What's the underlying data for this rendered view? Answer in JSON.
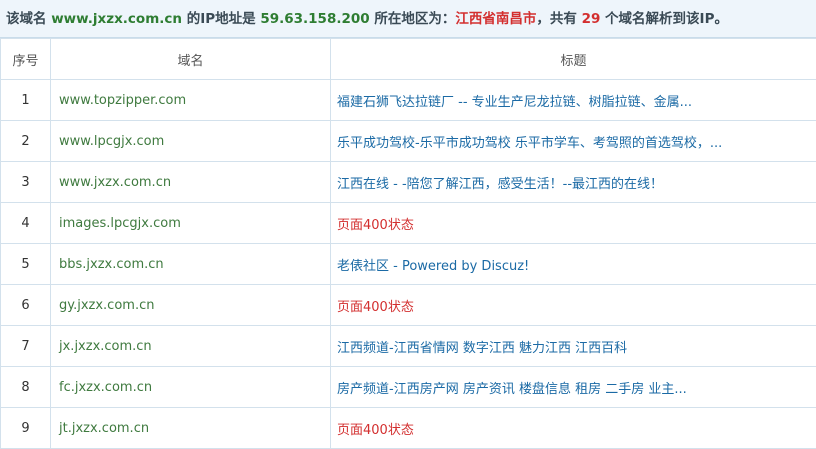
{
  "summary": {
    "prefix": "该域名 ",
    "domain": "www.jxzx.com.cn",
    "ip_label": " 的IP地址是 ",
    "ip": "59.63.158.200",
    "region_label": " 所在地区为：",
    "region": "江西省南昌市",
    "count_prefix": "，共有 ",
    "count": "29",
    "count_suffix": " 个域名解析到该IP。"
  },
  "table": {
    "headers": [
      "序号",
      "域名",
      "标题"
    ],
    "rows": [
      {
        "index": "1",
        "domain": "www.topzipper.com",
        "title": "福建石狮飞达拉链厂 -- 专业生产尼龙拉链、树脂拉链、金属...",
        "error": false
      },
      {
        "index": "2",
        "domain": "www.lpcgjx.com",
        "title": "乐平成功驾校-乐平市成功驾校 乐平市学车、考驾照的首选驾校，...",
        "error": false
      },
      {
        "index": "3",
        "domain": "www.jxzx.com.cn",
        "title": "江西在线 - -陪您了解江西，感受生活！--最江西的在线！",
        "error": false
      },
      {
        "index": "4",
        "domain": "images.lpcgjx.com",
        "title": "页面400状态",
        "error": true
      },
      {
        "index": "5",
        "domain": "bbs.jxzx.com.cn",
        "title": "老俵社区 - Powered by Discuz!",
        "error": false
      },
      {
        "index": "6",
        "domain": "gy.jxzx.com.cn",
        "title": "页面400状态",
        "error": true
      },
      {
        "index": "7",
        "domain": "jx.jxzx.com.cn",
        "title": "江西频道-江西省情网 数字江西 魅力江西 江西百科",
        "error": false
      },
      {
        "index": "8",
        "domain": "fc.jxzx.com.cn",
        "title": "房产频道-江西房产网 房产资讯 楼盘信息 租房 二手房 业主...",
        "error": false
      },
      {
        "index": "9",
        "domain": "jt.jxzx.com.cn",
        "title": "页面400状态",
        "error": true
      }
    ]
  }
}
